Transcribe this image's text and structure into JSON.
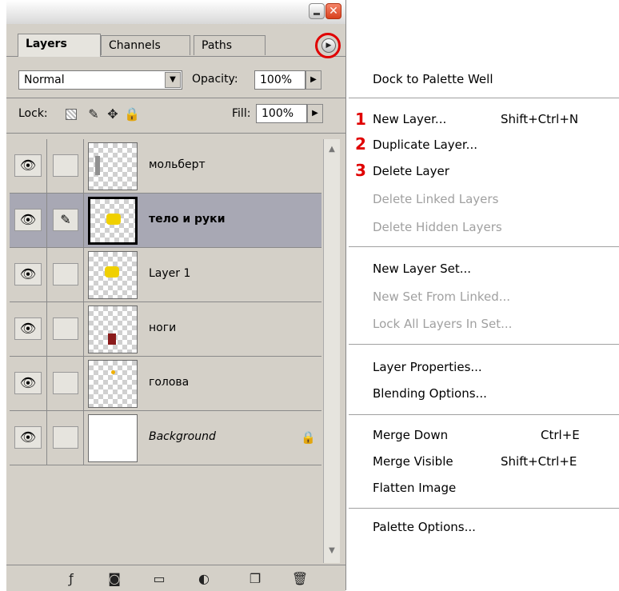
{
  "palette": {
    "tabs": [
      {
        "label": "Layers"
      },
      {
        "label": "Channels"
      },
      {
        "label": "Paths"
      }
    ],
    "blend_mode": "Normal",
    "opacity_label": "Opacity:",
    "opacity_value": "100%",
    "lock_label": "Lock:",
    "fill_label": "Fill:",
    "fill_value": "100%",
    "layers": [
      {
        "name": "мольберт"
      },
      {
        "name": "тело и руки"
      },
      {
        "name": "Layer 1"
      },
      {
        "name": "ноги"
      },
      {
        "name": "голова"
      },
      {
        "name": "Background"
      }
    ]
  },
  "menu": {
    "items": [
      {
        "label": "Dock to Palette Well"
      },
      {
        "label": "New Layer...",
        "shortcut": "Shift+Ctrl+N",
        "badge": "1"
      },
      {
        "label": "Duplicate Layer...",
        "badge": "2"
      },
      {
        "label": "Delete Layer",
        "badge": "3"
      },
      {
        "label": "Delete Linked Layers"
      },
      {
        "label": "Delete Hidden Layers"
      },
      {
        "label": "New Layer Set..."
      },
      {
        "label": "New Set From Linked..."
      },
      {
        "label": "Lock All Layers In Set..."
      },
      {
        "label": "Layer Properties..."
      },
      {
        "label": "Blending Options..."
      },
      {
        "label": "Merge Down",
        "shortcut": "Ctrl+E"
      },
      {
        "label": "Merge Visible",
        "shortcut": "Shift+Ctrl+E"
      },
      {
        "label": "Flatten Image"
      },
      {
        "label": "Palette Options..."
      }
    ]
  },
  "colors": {
    "highlight_circle": "#e00000",
    "badge": "#e00000",
    "selected_row": "#a8a8b4"
  }
}
